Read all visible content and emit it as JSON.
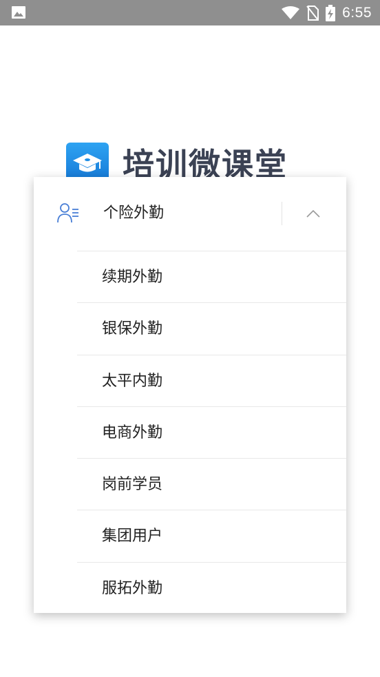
{
  "status_bar": {
    "time": "6:55",
    "icons": [
      "image-icon",
      "wifi-icon",
      "no-sim-icon",
      "battery-charging-icon"
    ]
  },
  "app": {
    "title": "培训微课堂",
    "logo_icon": "graduation-cap-icon"
  },
  "dropdown": {
    "selected": "个险外勤",
    "icon": "user-list-icon",
    "toggle_icon": "chevron-up-icon",
    "options": [
      {
        "label": "续期外勤"
      },
      {
        "label": "银保外勤"
      },
      {
        "label": "太平内勤"
      },
      {
        "label": "电商外勤"
      },
      {
        "label": "岗前学员"
      },
      {
        "label": "集团用户"
      },
      {
        "label": "服拓外勤"
      }
    ]
  },
  "colors": {
    "status_bar": "#8f8f8f",
    "accent_icon": "#4a7fd6",
    "logo_blue": "#1e8ee6",
    "title_text": "#3b4254"
  }
}
